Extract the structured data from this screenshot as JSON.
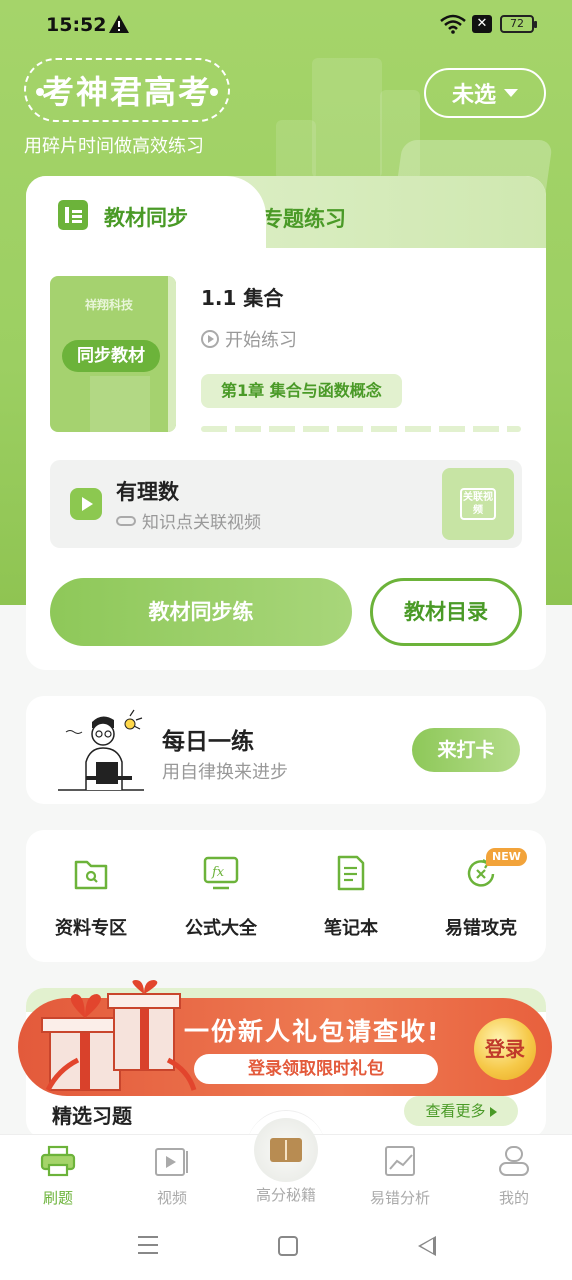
{
  "status_bar": {
    "time": "15:52",
    "battery": "72"
  },
  "header": {
    "logo_text": "考神君高考",
    "slogan": "用碎片时间做高效练习",
    "select_label": "未选"
  },
  "main_card": {
    "tabs": [
      {
        "label": "教材同步"
      },
      {
        "label": "专题练习"
      }
    ],
    "book": {
      "brand": "祥翔科技",
      "label": "同步教材"
    },
    "lesson_title": "1.1 集合",
    "start_label": "开始练习",
    "chapter_tag": "第1章 集合与函数概念",
    "video": {
      "title": "有理数",
      "subtitle": "知识点关联视频",
      "thumb_label": "关联视频"
    },
    "primary_button": "教材同步练",
    "outline_button": "教材目录"
  },
  "daily": {
    "title": "每日一练",
    "subtitle": "用自律换来进步",
    "button": "来打卡"
  },
  "tools": [
    {
      "label": "资料专区",
      "icon": "folder-icon"
    },
    {
      "label": "公式大全",
      "icon": "formula-icon"
    },
    {
      "label": "笔记本",
      "icon": "notebook-icon"
    },
    {
      "label": "易错攻克",
      "icon": "mistake-icon",
      "badge": "NEW"
    }
  ],
  "promo": {
    "title": "一份新人礼包请查收!",
    "subtitle": "登录领取限时礼包",
    "login": "登录"
  },
  "featured": {
    "title": "精选习题",
    "more": "查看更多"
  },
  "bottom_nav": [
    {
      "label": "刷题",
      "active": true
    },
    {
      "label": "视频"
    },
    {
      "label": "高分秘籍"
    },
    {
      "label": "易错分析"
    },
    {
      "label": "我的"
    }
  ],
  "colors": {
    "brand_green": "#6cb33a",
    "light_green": "#e2f1cf",
    "promo_red": "#e35a3b"
  }
}
